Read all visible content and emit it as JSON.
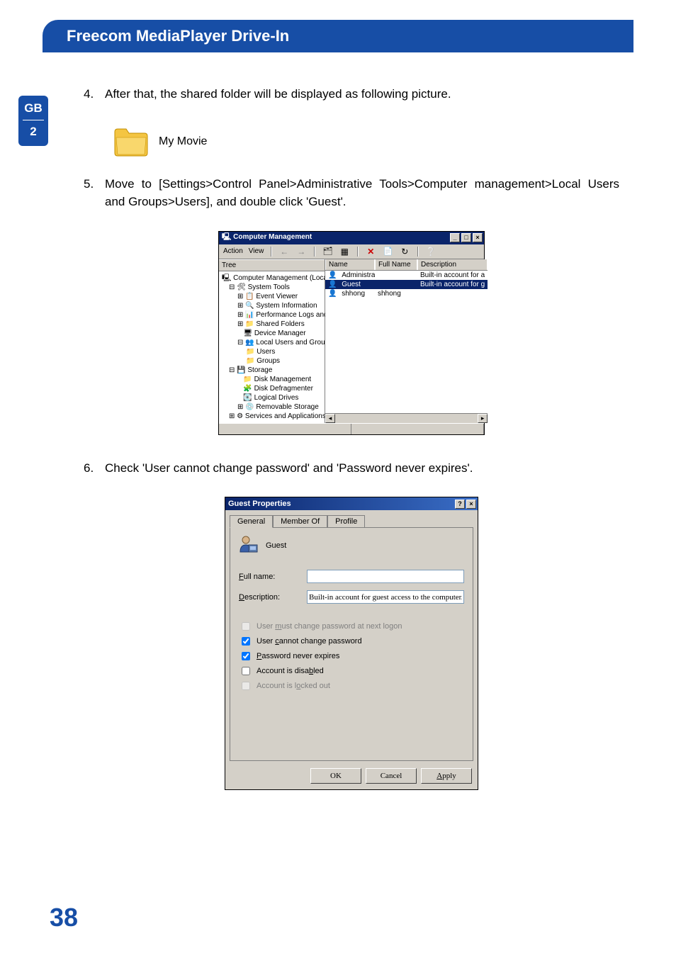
{
  "header": {
    "title": "Freecom MediaPlayer Drive-In"
  },
  "side_tab": {
    "top": "GB",
    "bottom": "2"
  },
  "page_number": "38",
  "steps": {
    "s4": {
      "num": "4.",
      "text": "After that, the shared folder will be displayed as following picture."
    },
    "folder_label": "My Movie",
    "s5": {
      "num": "5.",
      "text": "Move to [Settings>Control Panel>Administrative Tools>Computer management>Local Users and Groups>Users], and double click 'Guest'."
    },
    "s6": {
      "num": "6.",
      "text": "Check 'User cannot change password' and 'Password never expires'."
    }
  },
  "mgmt": {
    "title": "Computer Management",
    "menu": {
      "action": "Action",
      "view": "View"
    },
    "tree_tab": "Tree",
    "tree": {
      "root": "Computer Management (Local)",
      "sys_tools": "System Tools",
      "event_viewer": "Event Viewer",
      "sys_info": "System Information",
      "perf": "Performance Logs and Alerts",
      "shared": "Shared Folders",
      "devmgr": "Device Manager",
      "lug": "Local Users and Groups",
      "users": "Users",
      "groups": "Groups",
      "storage": "Storage",
      "diskmgmt": "Disk Management",
      "defrag": "Disk Defragmenter",
      "logical": "Logical Drives",
      "removable": "Removable Storage",
      "services": "Services and Applications"
    },
    "columns": {
      "name": "Name",
      "full": "Full Name",
      "desc": "Description"
    },
    "rows": [
      {
        "name": "Administrator",
        "full": "",
        "desc": "Built-in account for a"
      },
      {
        "name": "Guest",
        "full": "",
        "desc": "Built-in account for g",
        "selected": true
      },
      {
        "name": "shhong",
        "full": "shhong",
        "desc": ""
      }
    ]
  },
  "dlg": {
    "title": "Guest Properties",
    "tabs": {
      "general": "General",
      "member": "Member Of",
      "profile": "Profile"
    },
    "guest_label": "Guest",
    "fullname_label": "Full name:",
    "fullname_value": "",
    "desc_label": "Description:",
    "desc_value": "Built-in account for guest access to the computer/do",
    "chk_mustchange": "User must change password at next logon",
    "chk_cannot": "User cannot change password",
    "chk_never": "Password never expires",
    "chk_disabled": "Account is disabled",
    "chk_locked": "Account is locked out",
    "btn_ok": "OK",
    "btn_cancel": "Cancel",
    "btn_apply": "Apply"
  }
}
